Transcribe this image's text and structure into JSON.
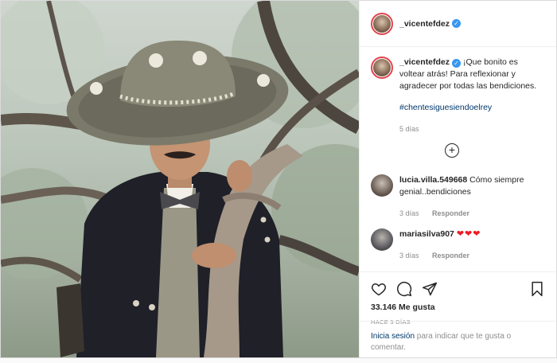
{
  "post": {
    "author": {
      "username": "_vicentefdez",
      "verified": true
    },
    "caption": {
      "username": "_vicentefdez",
      "text": "¡Que bonito es voltear atrás! Para reflexionar y agradecer por todas las bendiciones.",
      "hashtag": "#chentesiguesiendoelrey",
      "time": "5 días"
    },
    "load_more_icon": "plus-circle-icon",
    "comments": [
      {
        "username": "lucia.villa.549668",
        "text": "Cómo siempre genial..bendiciones",
        "time": "3 días",
        "reply_label": "Responder"
      },
      {
        "username": "mariasilva907",
        "text": "❤❤❤",
        "time": "3 días",
        "reply_label": "Responder"
      }
    ],
    "actions": {
      "like_icon": "heart-icon",
      "comment_icon": "comment-icon",
      "share_icon": "share-icon",
      "save_icon": "bookmark-icon"
    },
    "likes": "33.146 Me gusta",
    "posted_ago": "HACE 5 DÍAS",
    "login_prompt": {
      "link": "Inicia sesión",
      "text": " para indicar que te gusta o comentar."
    }
  },
  "colors": {
    "verified": "#3897f0",
    "link": "#00376b",
    "meta": "#8e8e8e",
    "hearts": "#ed1c24",
    "story_ring": "#e4434b"
  }
}
